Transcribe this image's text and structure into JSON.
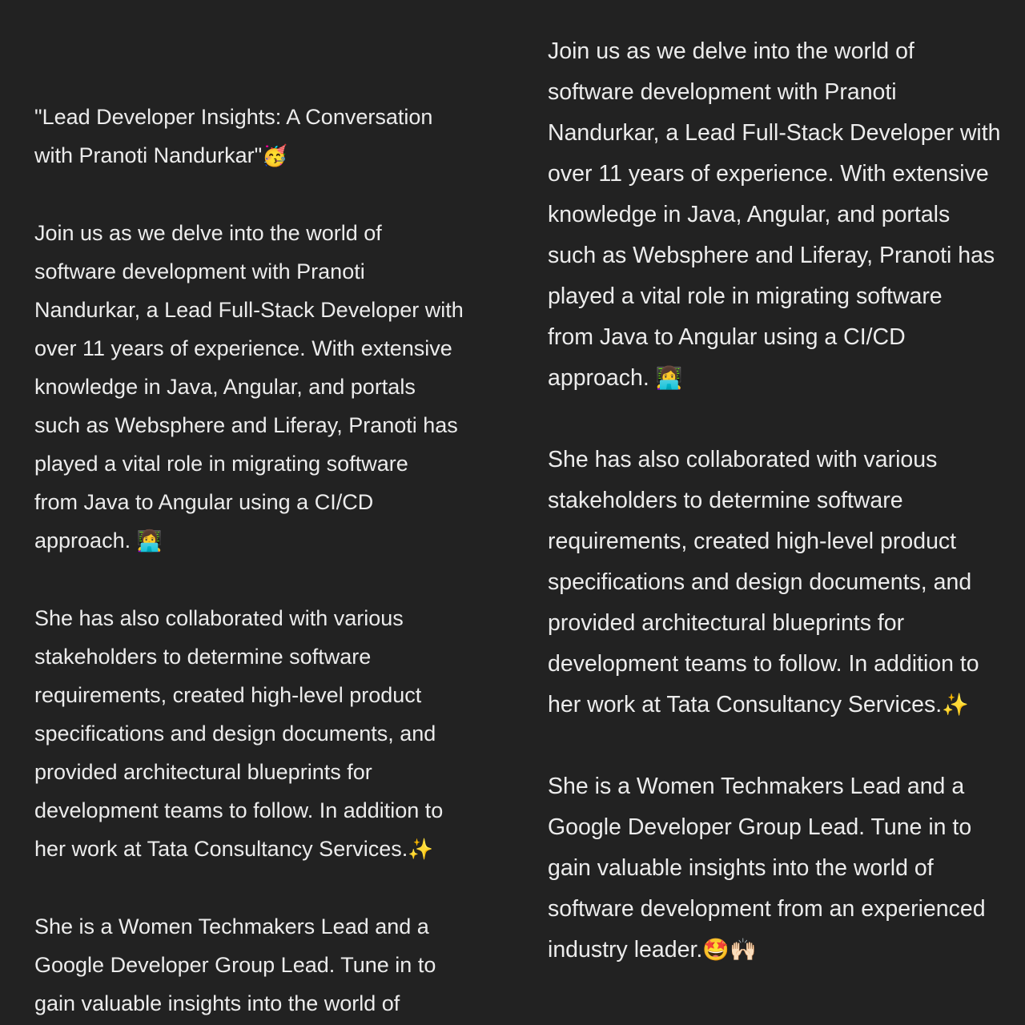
{
  "left_message": {
    "title_lines": [
      "\"Lead Developer Insights: A Conversation",
      "with Pranoti Nandurkar\""
    ],
    "title_emoji": "🥳",
    "intro_lines": [
      "Join us as we delve into the world of",
      "software development with Pranoti",
      "Nandurkar, a Lead Full-Stack Developer with",
      "over 11 years of experience. With extensive",
      "knowledge in Java, Angular, and portals",
      "such as Websphere and Liferay, Pranoti has",
      "played a vital role in migrating software",
      "from Java to Angular using a CI/CD",
      "approach. "
    ],
    "intro_emoji": "👩‍💻",
    "collab_lines": [
      "She has also collaborated with various",
      "stakeholders to determine software",
      "requirements, created high-level product",
      "specifications and design documents, and",
      "provided architectural blueprints for",
      "development teams to follow. In addition to",
      "her work at Tata Consultancy Services."
    ],
    "collab_emoji": "✨",
    "closing_lines": [
      "She is a Women Techmakers Lead and a",
      "Google Developer Group Lead. Tune in to",
      "gain valuable insights into the world of"
    ]
  },
  "right_message": {
    "intro_lines": [
      "Join us as we delve into the world of",
      "software development with Pranoti",
      "Nandurkar, a Lead Full-Stack Developer with",
      "over 11 years of experience. With extensive",
      "knowledge in Java, Angular, and portals",
      "such as Websphere and Liferay, Pranoti has",
      "played a vital role in migrating software",
      "from Java to Angular using a CI/CD",
      "approach. "
    ],
    "intro_emoji": "👩‍💻",
    "collab_lines": [
      "She has also collaborated with various",
      "stakeholders to determine software",
      "requirements, created high-level product",
      "specifications and design documents, and",
      "provided architectural blueprints for",
      "development teams to follow. In addition to",
      "her work at Tata Consultancy Services."
    ],
    "collab_emoji": "✨",
    "closing_lines": [
      "She is a Women Techmakers Lead and a",
      "Google Developer Group Lead. Tune in to",
      "gain valuable insights into the world of",
      "software development from an experienced",
      "industry leader."
    ],
    "closing_emojis": "🤩🙌🏻"
  },
  "colors": {
    "background": "#212121",
    "text": "#ececec"
  }
}
